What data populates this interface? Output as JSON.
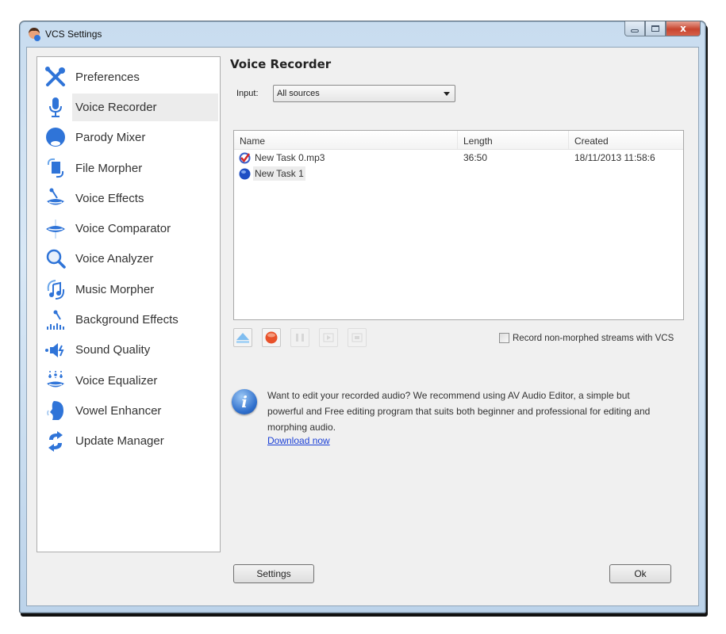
{
  "window": {
    "title": "VCS Settings",
    "controls": {
      "minimize": "minimize",
      "maximize": "maximize",
      "close": "x"
    }
  },
  "sidebar": {
    "selected_index": 1,
    "items": [
      {
        "label": "Preferences",
        "icon": "wrench-screwdriver-icon"
      },
      {
        "label": "Voice Recorder",
        "icon": "microphone-icon"
      },
      {
        "label": "Parody Mixer",
        "icon": "parody-mask-icon"
      },
      {
        "label": "File Morpher",
        "icon": "file-morph-icon"
      },
      {
        "label": "Voice Effects",
        "icon": "lips-microphone-icon"
      },
      {
        "label": "Voice Comparator",
        "icon": "lips-compare-icon"
      },
      {
        "label": "Voice Analyzer",
        "icon": "magnifier-icon"
      },
      {
        "label": "Music Morpher",
        "icon": "music-note-icon"
      },
      {
        "label": "Background Effects",
        "icon": "equalizer-mic-icon"
      },
      {
        "label": "Sound Quality",
        "icon": "speaker-icon"
      },
      {
        "label": "Voice Equalizer",
        "icon": "lips-equalizer-icon"
      },
      {
        "label": "Vowel Enhancer",
        "icon": "head-profile-icon"
      },
      {
        "label": "Update Manager",
        "icon": "update-arrows-icon"
      }
    ]
  },
  "main": {
    "title": "Voice Recorder",
    "input": {
      "label": "Input:",
      "value": "All sources"
    },
    "table": {
      "columns": [
        "Name",
        "Length",
        "Created"
      ],
      "rows": [
        {
          "name": "New Task 0.mp3",
          "length": "36:50",
          "created": "18/11/2013 11:58:6",
          "icon": "checked-task-icon",
          "selected": false
        },
        {
          "name": "New Task 1",
          "length": "",
          "created": "",
          "icon": "blue-task-icon",
          "selected": true
        }
      ]
    },
    "toolbar": {
      "buttons": [
        {
          "name": "eject",
          "enabled": true
        },
        {
          "name": "record",
          "enabled": true
        },
        {
          "name": "pause",
          "enabled": false
        },
        {
          "name": "play",
          "enabled": false
        },
        {
          "name": "stop",
          "enabled": false
        }
      ]
    },
    "checkbox": {
      "label": "Record non-morphed streams with VCS",
      "checked": false
    },
    "info": {
      "text": "Want to edit your recorded audio? We recommend using AV Audio Editor, a simple but powerful and Free editing program that suits both beginner and professional for editing and morphing audio.",
      "link": "Download now"
    },
    "buttons": {
      "settings": "Settings",
      "ok": "Ok"
    }
  },
  "colors": {
    "accent_icon": "#2f74d8",
    "link": "#1a3fd6",
    "close_button": "#c8452f"
  }
}
